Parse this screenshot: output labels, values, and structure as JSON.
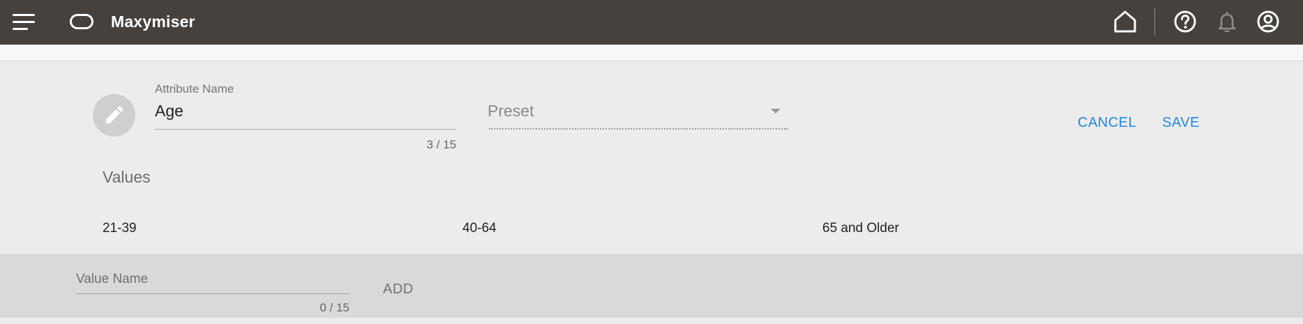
{
  "app": {
    "brand": "Maxymiser"
  },
  "header": {
    "icons": [
      "menu-icon",
      "oracle-logo",
      "home-icon",
      "help-icon",
      "notifications-icon",
      "account-icon"
    ]
  },
  "attribute": {
    "label": "Attribute Name",
    "value": "Age",
    "counter": "3 / 15"
  },
  "preset": {
    "placeholder": "Preset"
  },
  "actions": {
    "cancel": "CANCEL",
    "save": "SAVE"
  },
  "values": {
    "heading": "Values",
    "items": [
      "21-39",
      "40-64",
      "65 and Older"
    ]
  },
  "new_value": {
    "placeholder": "Value Name",
    "counter": "0 / 15",
    "add_label": "ADD"
  },
  "colors": {
    "header_bg": "#46413c",
    "accent": "#1e88e5",
    "panel_bg": "#ececec",
    "add_bar_bg": "#d9d9d9"
  }
}
